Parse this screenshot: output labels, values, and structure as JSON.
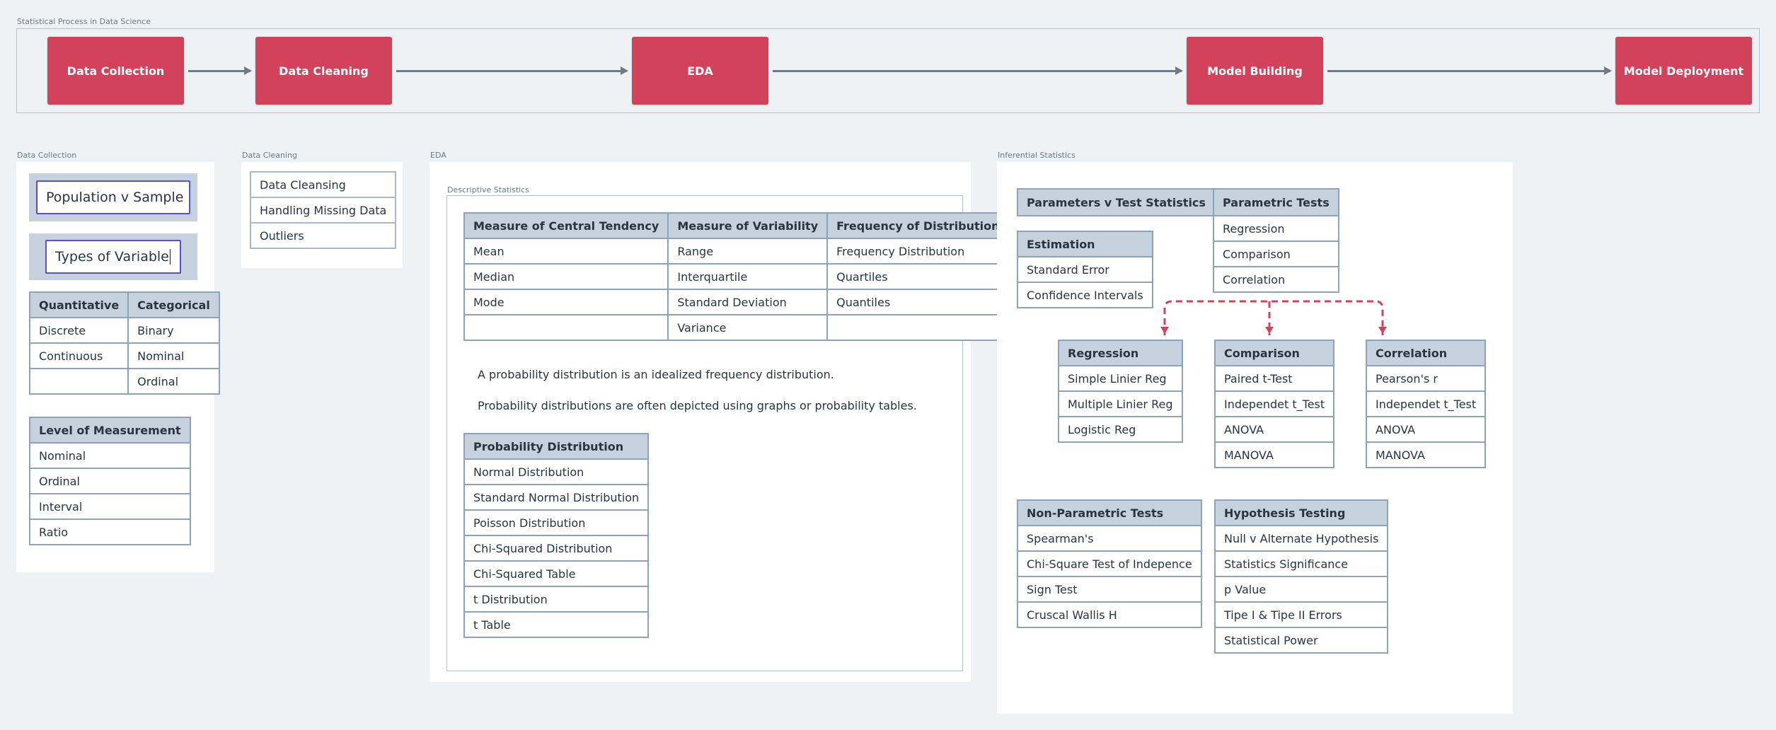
{
  "process": {
    "label": "Statistical Process in Data Science",
    "stages": [
      "Data Collection",
      "Data Cleaning",
      "EDA",
      "Model Building",
      "Model Deployment"
    ]
  },
  "data_collection": {
    "label": "Data Collection",
    "fields": [
      "Population v Sample",
      "Types of Variable"
    ],
    "variables_table": {
      "headers": [
        "Quantitative",
        "Categorical"
      ],
      "rows": [
        [
          "Discrete",
          "Binary"
        ],
        [
          "Continuous",
          "Nominal"
        ],
        [
          "",
          "Ordinal"
        ]
      ]
    },
    "measurement_table": {
      "header": "Level of Measurement",
      "items": [
        "Nominal",
        "Ordinal",
        "Interval",
        "Ratio"
      ]
    }
  },
  "data_cleaning": {
    "label": "Data Cleaning",
    "items": [
      "Data Cleansing",
      "Handling Missing Data",
      "Outliers"
    ]
  },
  "eda": {
    "label": "EDA",
    "descriptive_label": "Descriptive Statistics",
    "descriptive_table": {
      "headers": [
        "Measure of Central Tendency",
        "Measure of Variability",
        "Frequency of Distribution"
      ],
      "rows": [
        [
          "Mean",
          "Range",
          "Frequency Distribution"
        ],
        [
          "Median",
          "Interquartile",
          "Quartiles"
        ],
        [
          "Mode",
          "Standard Deviation",
          "Quantiles"
        ],
        [
          "",
          "Variance",
          ""
        ]
      ]
    },
    "text1": "A probability distribution is an idealized frequency distribution.",
    "text2": "Probability distributions are often depicted using graphs or probability tables.",
    "probability_table": {
      "header": "Probability Distribution",
      "items": [
        "Normal Distribution",
        "Standard Normal Distribution",
        "Poisson Distribution",
        "Chi-Squared Distribution",
        "Chi-Squared Table",
        "t Distribution",
        "t Table"
      ]
    }
  },
  "inferential": {
    "label": "Inferential Statistics",
    "params_header": "Parameters v Test Statistics",
    "estimation": {
      "header": "Estimation",
      "items": [
        "Standard Error",
        "Confidence Intervals"
      ]
    },
    "parametric": {
      "header": "Parametric Tests",
      "items": [
        "Regression",
        "Comparison",
        "Correlation"
      ]
    },
    "regression": {
      "header": "Regression",
      "items": [
        "Simple Linier Reg",
        "Multiple Linier Reg",
        "Logistic Reg"
      ]
    },
    "comparison": {
      "header": "Comparison",
      "items": [
        "Paired t-Test",
        "Independet t_Test",
        "ANOVA",
        "MANOVA"
      ]
    },
    "correlation": {
      "header": "Correlation",
      "items": [
        "Pearson's r",
        "Independet t_Test",
        "ANOVA",
        "MANOVA"
      ]
    },
    "nonparametric": {
      "header": "Non-Parametric Tests",
      "items": [
        "Spearman's",
        "Chi-Square Test of Indepence",
        "Sign Test",
        "Cruscal Wallis H"
      ]
    },
    "hypothesis": {
      "header": "Hypothesis Testing",
      "items": [
        "Null v Alternate Hypothesis",
        "Statistics Significance",
        "p Value",
        "Tipe I & Tipe II Errors",
        "Statistical Power"
      ]
    }
  },
  "colors": {
    "stage": "#d3425b",
    "arrow": "#6f7b86",
    "header_fill": "#c5d1dc",
    "border": "#8ea3b8",
    "connector": "#d3425b",
    "field_border": "#5a4fd6"
  }
}
